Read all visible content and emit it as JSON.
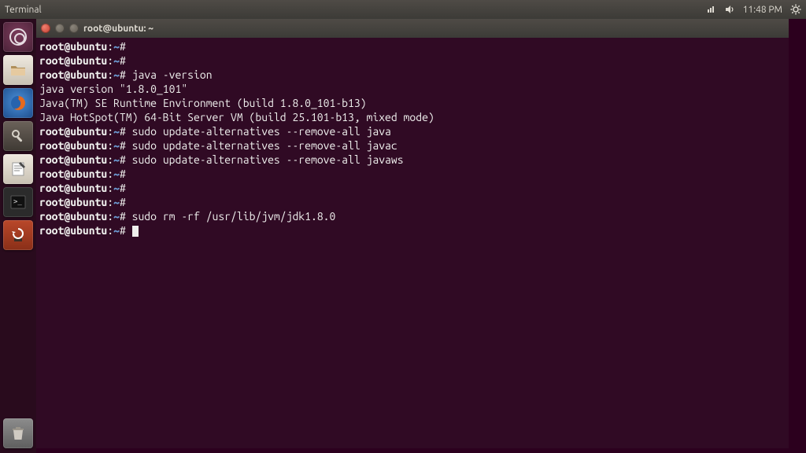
{
  "menubar": {
    "app_title": "Terminal",
    "time": "11:48 PM"
  },
  "launcher": {
    "dash": "dash-icon",
    "files": "files-icon",
    "firefox": "firefox-icon",
    "settings": "settings-icon",
    "editor": "text-editor-icon",
    "terminal": "terminal-icon",
    "updates": "software-updater-icon",
    "trash": "trash-icon"
  },
  "window": {
    "title": "root@ubuntu: ~"
  },
  "terminal": {
    "prompt_user": "root@ubuntu",
    "prompt_sep": ":",
    "prompt_path": "~",
    "prompt_char": "#",
    "lines": [
      {
        "type": "prompt",
        "cmd": ""
      },
      {
        "type": "prompt",
        "cmd": ""
      },
      {
        "type": "prompt",
        "cmd": "java -version"
      },
      {
        "type": "output",
        "text": "java version \"1.8.0_101\""
      },
      {
        "type": "output",
        "text": "Java(TM) SE Runtime Environment (build 1.8.0_101-b13)"
      },
      {
        "type": "output",
        "text": "Java HotSpot(TM) 64-Bit Server VM (build 25.101-b13, mixed mode)"
      },
      {
        "type": "prompt",
        "cmd": "sudo update-alternatives --remove-all java"
      },
      {
        "type": "prompt",
        "cmd": "sudo update-alternatives --remove-all javac"
      },
      {
        "type": "prompt",
        "cmd": "sudo update-alternatives --remove-all javaws"
      },
      {
        "type": "prompt",
        "cmd": ""
      },
      {
        "type": "prompt",
        "cmd": ""
      },
      {
        "type": "prompt",
        "cmd": ""
      },
      {
        "type": "prompt",
        "cmd": "sudo rm -rf /usr/lib/jvm/jdk1.8.0"
      },
      {
        "type": "prompt",
        "cmd": "",
        "cursor": true
      }
    ]
  }
}
